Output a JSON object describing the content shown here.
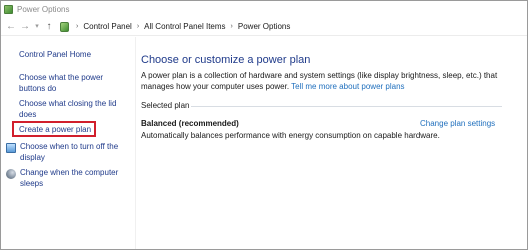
{
  "window": {
    "title": "Power Options"
  },
  "nav": {
    "back_icon": "←",
    "forward_icon": "→",
    "dropdown_icon": "▾",
    "up_icon": "↑",
    "separator": "›"
  },
  "breadcrumb": {
    "items": [
      "Control Panel",
      "All Control Panel Items",
      "Power Options"
    ]
  },
  "left_pane": {
    "home": "Control Panel Home",
    "links": [
      "Choose what the power buttons do",
      "Choose what closing the lid does",
      "Create a power plan",
      "Choose when to turn off the display",
      "Change when the computer sleeps"
    ]
  },
  "main": {
    "heading": "Choose or customize a power plan",
    "description": "A power plan is a collection of hardware and system settings (like display brightness, sleep, etc.) that manages how your computer uses power.",
    "description_link": "Tell me more about power plans",
    "selected_plan_label": "Selected plan",
    "plan": {
      "name": "Balanced (recommended)",
      "change_link": "Change plan settings",
      "description": "Automatically balances performance with energy consumption on capable hardware."
    }
  },
  "colors": {
    "link": "#1f3a8a",
    "accent_link": "#1f6fbd",
    "highlight": "#d11f2c"
  }
}
